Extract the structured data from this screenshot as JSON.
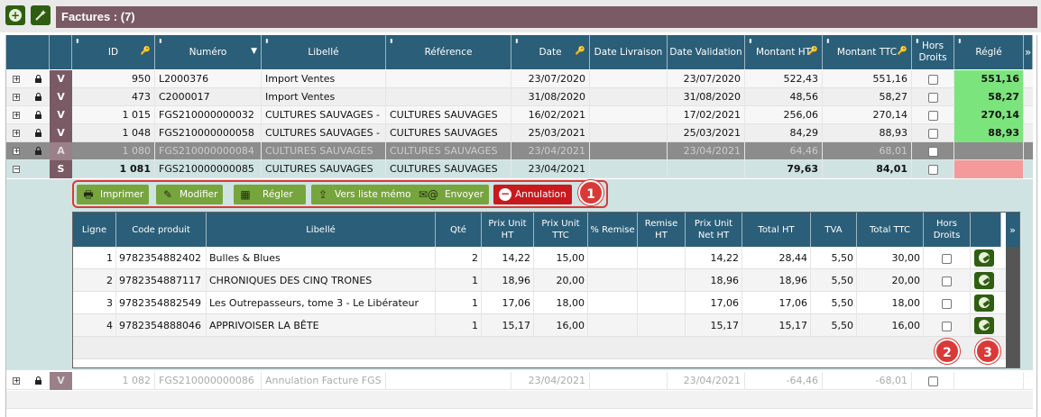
{
  "toolbar": {
    "add_icon": "plus-circle-icon",
    "wand_icon": "magic-wand-icon"
  },
  "title": "Factures : (7)",
  "columns": {
    "id": "ID",
    "numero": "Numéro",
    "libelle": "Libellé",
    "reference": "Référence",
    "date": "Date",
    "date_livraison": "Date Livraison",
    "date_validation": "Date Validation",
    "montant_ht": "Montant HT",
    "montant_ttc": "Montant TTC",
    "hors_droits_1": "Hors",
    "hors_droits_2": "Droits",
    "regle": "Réglé"
  },
  "rows": [
    {
      "exp": "+",
      "status": "V",
      "id": "950",
      "numero": "L2000376",
      "libelle": "Import Ventes",
      "reference": "",
      "date": "23/07/2020",
      "date_validation": "23/07/2020",
      "montant_ht": "522,43",
      "montant_ttc": "551,16",
      "regle": "551,16"
    },
    {
      "exp": "+",
      "status": "V",
      "id": "473",
      "numero": "C2000017",
      "libelle": "Import Ventes",
      "reference": "",
      "date": "31/08/2020",
      "date_validation": "31/08/2020",
      "montant_ht": "48,56",
      "montant_ttc": "58,27",
      "regle": "58,27"
    },
    {
      "exp": "+",
      "status": "V",
      "id": "1 015",
      "numero": "FGS210000000032",
      "libelle": "CULTURES SAUVAGES -",
      "reference": "CULTURES SAUVAGES",
      "date": "16/02/2021",
      "date_validation": "17/02/2021",
      "montant_ht": "256,06",
      "montant_ttc": "270,14",
      "regle": "270,14"
    },
    {
      "exp": "+",
      "status": "V",
      "id": "1 048",
      "numero": "FGS210000000058",
      "libelle": "CULTURES SAUVAGES -",
      "reference": "CULTURES SAUVAGES",
      "date": "25/03/2021",
      "date_validation": "25/03/2021",
      "montant_ht": "84,29",
      "montant_ttc": "88,93",
      "regle": "88,93"
    },
    {
      "exp": "+",
      "status": "A",
      "id": "1 080",
      "numero": "FGS210000000084",
      "libelle": "CULTURES SAUVAGES",
      "reference": "CULTURES SAUVAGES",
      "date": "23/04/2021",
      "date_validation": "23/04/2021",
      "montant_ht": "64,46",
      "montant_ttc": "68,01",
      "regle": ""
    },
    {
      "exp": "−",
      "status": "S",
      "id": "1 081",
      "numero": "FGS210000000085",
      "libelle": "CULTURES SAUVAGES",
      "reference": "CULTURES SAUVAGES",
      "date": "23/04/2021",
      "date_validation": "",
      "montant_ht": "79,63",
      "montant_ttc": "84,01",
      "regle": ""
    }
  ],
  "actions": {
    "imprimer": "Imprimer",
    "modifier": "Modifier",
    "regler": "Régler",
    "vers_liste_memo": "Vers liste mémo",
    "envoyer": "Envoyer",
    "annulation": "Annulation"
  },
  "annotations": {
    "a1": "1",
    "a2": "2",
    "a3": "3"
  },
  "sub_columns": {
    "ligne": "Ligne",
    "code_produit": "Code produit",
    "libelle": "Libellé",
    "qte": "Qté",
    "prix_unit_ht_1": "Prix Unit",
    "prix_unit_ht_2": "HT",
    "prix_unit_ttc_1": "Prix Unit",
    "prix_unit_ttc_2": "TTC",
    "pct_remise": "% Remise",
    "remise_ht": "Remise HT",
    "prix_net_1": "Prix Unit",
    "prix_net_2": "Net HT",
    "total_ht": "Total HT",
    "tva": "TVA",
    "total_ttc": "Total TTC",
    "hors_droits_1": "Hors",
    "hors_droits_2": "Droits"
  },
  "lines": [
    {
      "ligne": "1",
      "code": "9782354882402",
      "libelle": "Bulles & Blues",
      "qte": "2",
      "pu_ht": "14,22",
      "pu_ttc": "15,00",
      "pu_net": "14,22",
      "total_ht": "28,44",
      "tva": "5,50",
      "total_ttc": "30,00"
    },
    {
      "ligne": "2",
      "code": "9782354887117",
      "libelle": "CHRONIQUES DES CINQ TRONES",
      "qte": "1",
      "pu_ht": "18,96",
      "pu_ttc": "20,00",
      "pu_net": "18,96",
      "total_ht": "18,96",
      "tva": "5,50",
      "total_ttc": "20,00"
    },
    {
      "ligne": "3",
      "code": "9782354882549",
      "libelle": "Les Outrepasseurs, tome 3 - Le Libérateur",
      "qte": "1",
      "pu_ht": "17,06",
      "pu_ttc": "18,00",
      "pu_net": "17,06",
      "total_ht": "17,06",
      "tva": "5,50",
      "total_ttc": "18,00"
    },
    {
      "ligne": "4",
      "code": "9782354888046",
      "libelle": "APPRIVOISER LA BÊTE",
      "qte": "1",
      "pu_ht": "15,17",
      "pu_ttc": "16,00",
      "pu_net": "15,17",
      "total_ht": "15,17",
      "tva": "5,50",
      "total_ttc": "16,00"
    }
  ],
  "last_row": {
    "exp": "+",
    "status": "V",
    "id": "1 082",
    "numero": "FGS210000000086",
    "libelle": "Annulation Facture FGS",
    "date": "23/04/2021",
    "date_validation": "23/04/2021",
    "montant_ht": "-64,46",
    "montant_ttc": "-68,01"
  },
  "colors": {
    "header": "#2b5e78",
    "title_bar": "#7a5a64",
    "paid": "#7ce47c",
    "unpaid": "#f49a9a",
    "action": "#77a53d",
    "cancel": "#c8191d",
    "annotation": "#d93a38"
  }
}
